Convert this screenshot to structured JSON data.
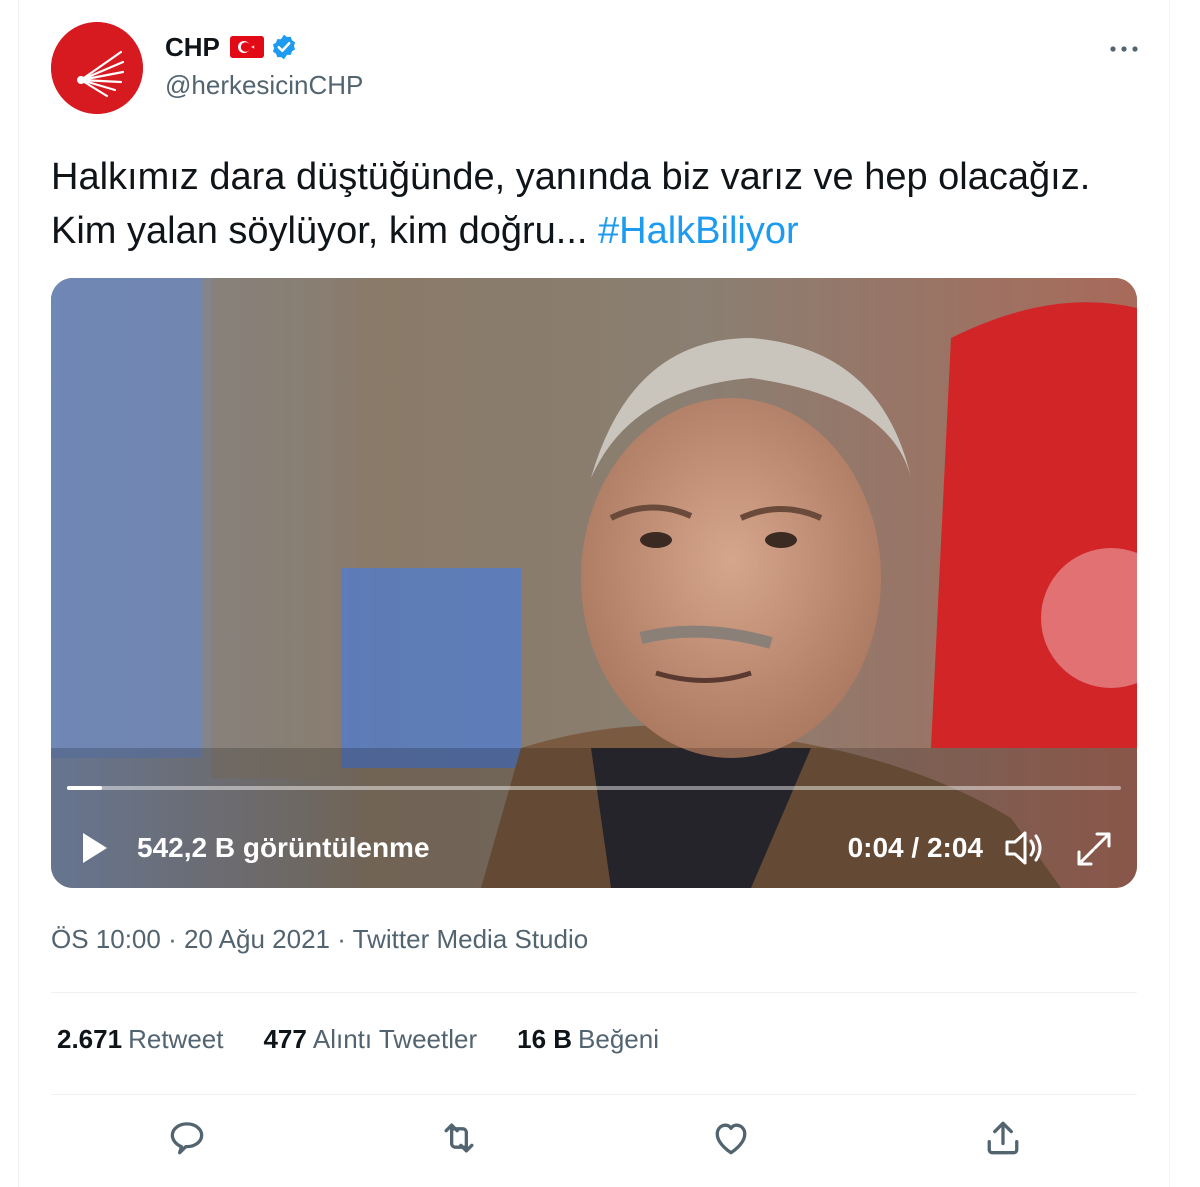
{
  "author": {
    "name": "CHP",
    "handle": "@herkesicinCHP",
    "flag_icon": "turkey-flag-icon",
    "verified_icon": "verified-badge-icon",
    "brand_color": "#d71920",
    "verified_color": "#1d9bf0"
  },
  "tweet": {
    "text": "Halkımız dara düştüğünde, yanında biz varız ve hep olacağız. Kim yalan söylüyor, kim doğru... ",
    "hashtag": "#HalkBiliyor",
    "hashtag_color": "#1d9bf0"
  },
  "video": {
    "views": "542,2 B görüntülenme",
    "time": "0:04 / 2:04",
    "progress": 0.033
  },
  "meta": {
    "time": "ÖS 10:00",
    "sep1": " · ",
    "date": "20 Ağu 2021",
    "sep2": " · ",
    "source": "Twitter Media Studio"
  },
  "stats": [
    {
      "value": "2.671",
      "label": "Retweet"
    },
    {
      "value": "477",
      "label": "Alıntı Tweetler"
    },
    {
      "value": "16 B",
      "label": "Beğeni"
    }
  ],
  "actions": [
    "reply-icon",
    "retweet-icon",
    "like-icon",
    "share-icon"
  ]
}
